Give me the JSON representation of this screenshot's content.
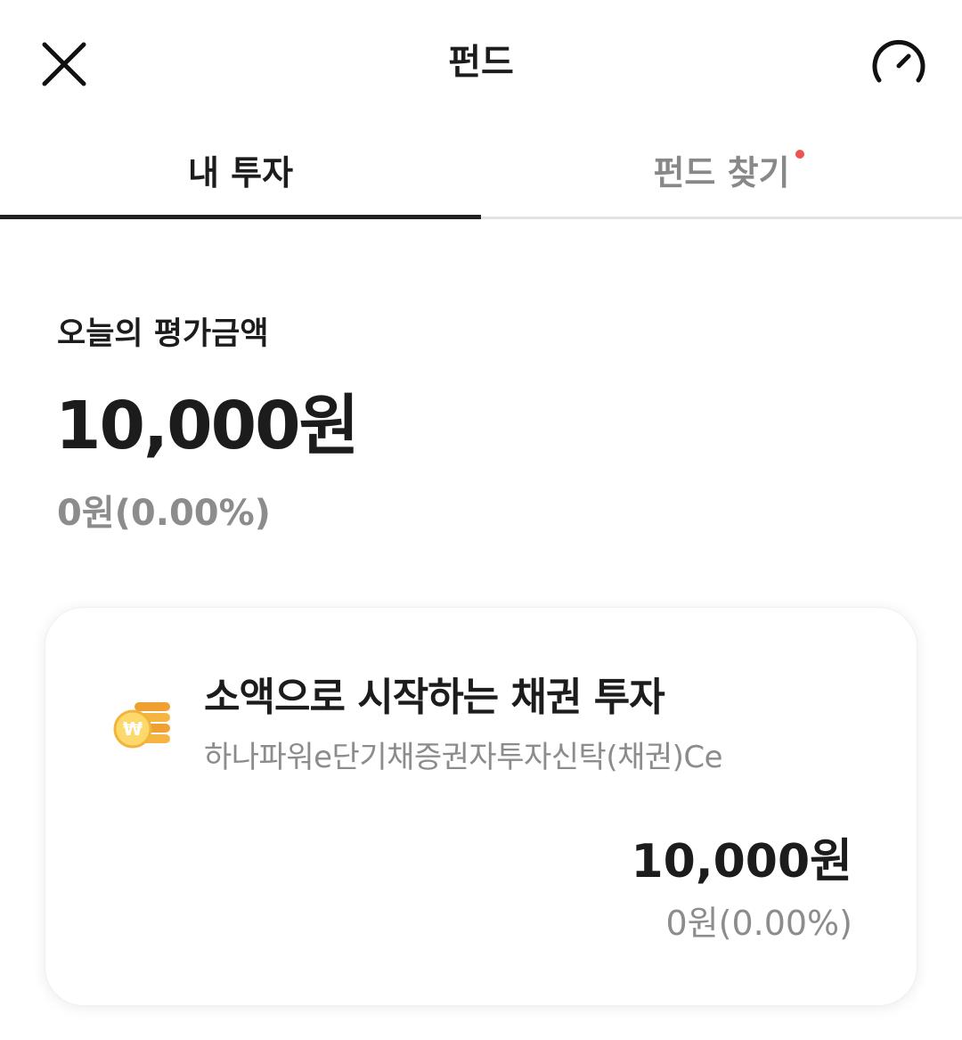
{
  "header": {
    "title": "펀드",
    "close_icon": "close-icon",
    "speed_icon": "speedometer-icon"
  },
  "tabs": [
    {
      "label": "내 투자",
      "active": true
    },
    {
      "label": "펀드 찾기",
      "active": false,
      "has_dot": true
    }
  ],
  "summary": {
    "label": "오늘의 평가금액",
    "amount": "10,000원",
    "change": "0원(0.00%)"
  },
  "fund_card": {
    "icon": "coin-stack-icon",
    "title": "소액으로 시작하는 채권 투자",
    "subtitle": "하나파워e단기채증권자투자신탁(채권)Ce",
    "amount": "10,000원",
    "change": "0원(0.00%)"
  },
  "colors": {
    "text_primary": "#1c1c1c",
    "text_secondary": "#8c8c8c",
    "tab_active_underline": "#222222",
    "notification_dot": "#ef5350",
    "coin": "#f6b23a"
  }
}
